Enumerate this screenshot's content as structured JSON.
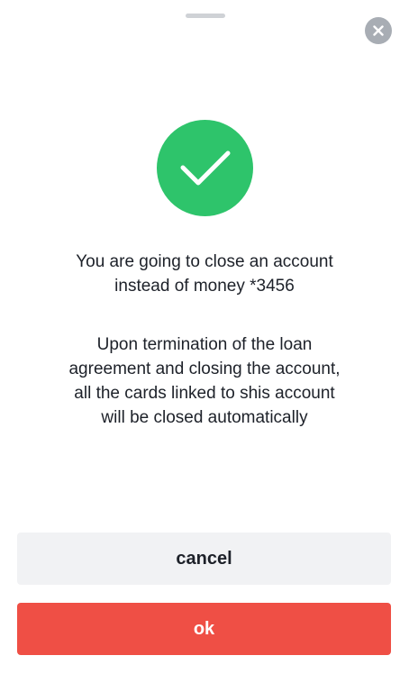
{
  "sheet": {
    "close_icon": "close-icon",
    "success_icon": "checkmark-icon"
  },
  "message": {
    "primary": "You are going to close an account\ninstead of money *3456",
    "secondary": "Upon termination of the loan\nagreement and closing the account,\nall the cards linked to shis account\nwill be closed automatically"
  },
  "actions": {
    "cancel_label": "cancel",
    "ok_label": "ok"
  },
  "colors": {
    "success": "#2ec46b",
    "danger": "#ef4f45",
    "secondary_button": "#f1f2f4",
    "close_button": "#a8adb4"
  }
}
